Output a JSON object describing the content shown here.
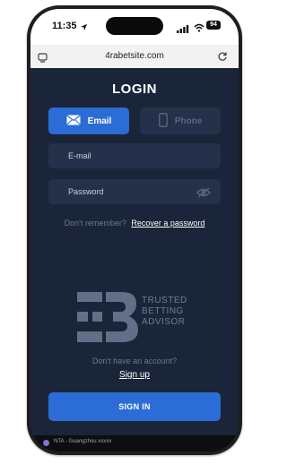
{
  "status_bar": {
    "time": "11:35",
    "battery": "94",
    "icons": [
      "location-arrow-icon",
      "signal-icon",
      "wifi-icon",
      "battery-icon"
    ]
  },
  "browser": {
    "url": "4rabetsite.com",
    "icons": [
      "tabs-icon",
      "reload-icon"
    ]
  },
  "login": {
    "title": "LOGIN",
    "tabs": [
      {
        "label": "Email",
        "icon": "envelope-icon",
        "active": true
      },
      {
        "label": "Phone",
        "icon": "phone-icon",
        "active": false
      }
    ],
    "email_placeholder": "E-mail",
    "password_placeholder": "Password",
    "forgot_text": "Don't remember?",
    "recover_link": "Recover a password",
    "no_account_text": "Don't have an account?",
    "signup_link": "Sign up",
    "signin_button": "SIGN IN"
  },
  "watermark": {
    "line1": "TRUSTED",
    "line2": "BETTING",
    "line3": "ADVISOR"
  },
  "notification": {
    "text": "NTA - Guangzhou xxxxx"
  },
  "colors": {
    "background": "#1b2539",
    "field": "#25304a",
    "accent": "#2b6cd6",
    "muted_text": "#6c7893"
  }
}
